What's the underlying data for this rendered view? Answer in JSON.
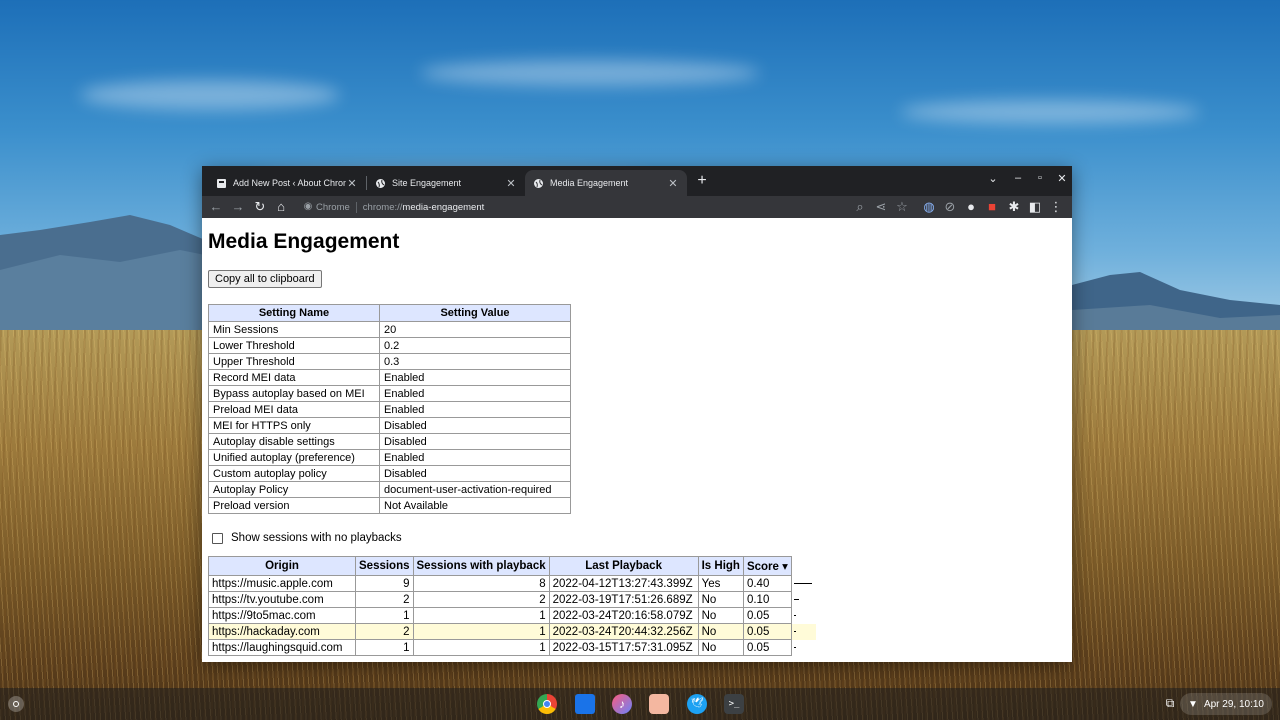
{
  "browser": {
    "tabs": [
      {
        "title": "Add New Post ‹ About Chromebooks",
        "icon": "wordpress-icon",
        "active": false
      },
      {
        "title": "Site Engagement",
        "icon": "globe-icon",
        "active": false
      },
      {
        "title": "Media Engagement",
        "icon": "globe-icon",
        "active": true
      }
    ],
    "new_tab": "+",
    "omnibox": {
      "chip": "Chrome",
      "scheme": "chrome://",
      "path": "media-engagement"
    }
  },
  "page": {
    "title": "Media Engagement",
    "copy_button": "Copy all to clipboard",
    "settings_headers": [
      "Setting Name",
      "Setting Value"
    ],
    "settings": [
      [
        "Min Sessions",
        "20"
      ],
      [
        "Lower Threshold",
        "0.2"
      ],
      [
        "Upper Threshold",
        "0.3"
      ],
      [
        "Record MEI data",
        "Enabled"
      ],
      [
        "Bypass autoplay based on MEI",
        "Enabled"
      ],
      [
        "Preload MEI data",
        "Enabled"
      ],
      [
        "MEI for HTTPS only",
        "Disabled"
      ],
      [
        "Autoplay disable settings",
        "Disabled"
      ],
      [
        "Unified autoplay (preference)",
        "Enabled"
      ],
      [
        "Custom autoplay policy",
        "Disabled"
      ],
      [
        "Autoplay Policy",
        "document-user-activation-required"
      ],
      [
        "Preload version",
        "Not Available"
      ]
    ],
    "show_no_playbacks_label": "Show sessions with no playbacks",
    "engagement_headers": [
      "Origin",
      "Sessions",
      "Sessions with playback",
      "Last Playback",
      "Is High",
      "Score ▾"
    ],
    "engagement_rows": [
      {
        "origin": "https://music.apple.com",
        "sessions": "9",
        "playback": "8",
        "last": "2022-04-12T13:27:43.399Z",
        "high": "Yes",
        "score": "0.40",
        "bar": 0.4,
        "highlight": false
      },
      {
        "origin": "https://tv.youtube.com",
        "sessions": "2",
        "playback": "2",
        "last": "2022-03-19T17:51:26.689Z",
        "high": "No",
        "score": "0.10",
        "bar": 0.1,
        "highlight": false
      },
      {
        "origin": "https://9to5mac.com",
        "sessions": "1",
        "playback": "1",
        "last": "2022-03-24T20:16:58.079Z",
        "high": "No",
        "score": "0.05",
        "bar": 0.05,
        "highlight": false
      },
      {
        "origin": "https://hackaday.com",
        "sessions": "2",
        "playback": "1",
        "last": "2022-03-24T20:44:32.256Z",
        "high": "No",
        "score": "0.05",
        "bar": 0.05,
        "highlight": true
      },
      {
        "origin": "https://laughingsquid.com",
        "sessions": "1",
        "playback": "1",
        "last": "2022-03-15T17:57:31.095Z",
        "high": "No",
        "score": "0.05",
        "bar": 0.05,
        "highlight": false
      }
    ]
  },
  "shelf": {
    "apps": [
      "chrome-icon",
      "files-icon",
      "music-icon",
      "photos-icon",
      "twitter-icon",
      "terminal-icon"
    ],
    "date_time": "Apr 29, 10:10"
  }
}
